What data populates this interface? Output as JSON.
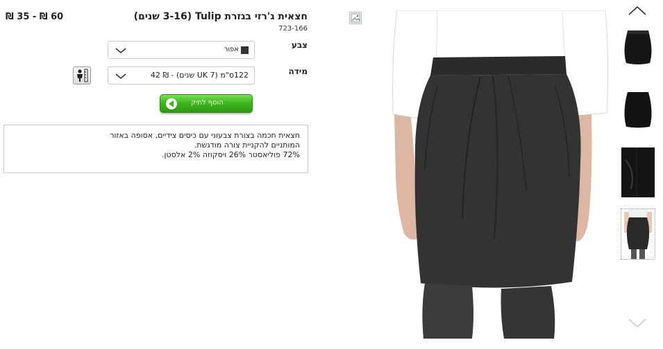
{
  "product": {
    "title": "חצאית ג'רזי בגזרת Tulip (3-16 שנים)",
    "sku": "723-166",
    "price": "60 ₪ - 35 ₪"
  },
  "options": {
    "color_label": "צבע",
    "color_value": "אפור",
    "size_label": "מידה",
    "size_value": "122ס\"מ (UK 7 שנים) - ₪ 42"
  },
  "actions": {
    "add_to_cart": "הוסף לתיק"
  },
  "description": {
    "lines": [
      "חצאית חכמה בצורת צבעוני עם כיסים צידיים, אסופה באזור",
      "המותניים להקניית צורה מודגשת.",
      "72% פוליאסטר 26% ויסקוזה 2% אלסטן."
    ]
  },
  "icons": {
    "thumb_up": "chevron-up-icon",
    "thumb_down": "chevron-down-icon",
    "size_guide": "size-guide-icon",
    "broken_image": "broken-image-icon"
  },
  "colors": {
    "button_green": "#3fb61e",
    "swatch_grey": "#333333"
  }
}
